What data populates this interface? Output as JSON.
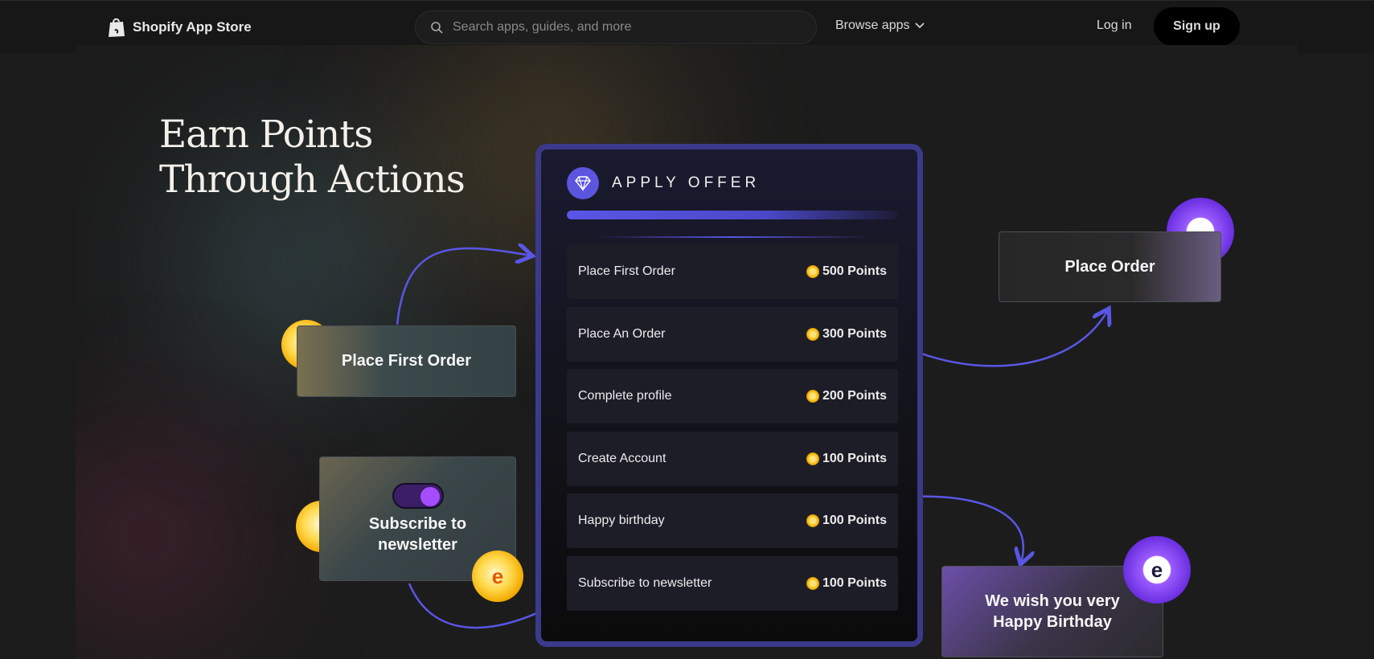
{
  "nav": {
    "brand": "Shopify App Store",
    "search_placeholder": "Search apps, guides, and more",
    "browse_label": "Browse apps",
    "login_label": "Log in",
    "signup_label": "Sign up"
  },
  "hero": {
    "headline_line1": "Earn Points",
    "headline_line2": "Through Actions"
  },
  "offer_panel": {
    "title": "APPLY OFFER",
    "rows": [
      {
        "label": "Place First Order",
        "points": "500 Points"
      },
      {
        "label": "Place An Order",
        "points": "300 Points"
      },
      {
        "label": "Complete profile",
        "points": "200 Points"
      },
      {
        "label": "Create Account",
        "points": "100 Points"
      },
      {
        "label": "Happy birthday",
        "points": "100 Points"
      },
      {
        "label": "Subscribe to newsletter",
        "points": "100 Points"
      }
    ]
  },
  "cards": {
    "first_order": "Place First Order",
    "subscribe_line1": "Subscribe to",
    "subscribe_line2": "newsletter",
    "place_order": "Place Order",
    "birthday_line1": "We wish you very",
    "birthday_line2": "Happy Birthday"
  },
  "colors": {
    "accent": "#5a56e6",
    "panel_border": "#3b3a8a",
    "coin_gold": "#f2a900",
    "coin_purple": "#7b3cf0"
  }
}
